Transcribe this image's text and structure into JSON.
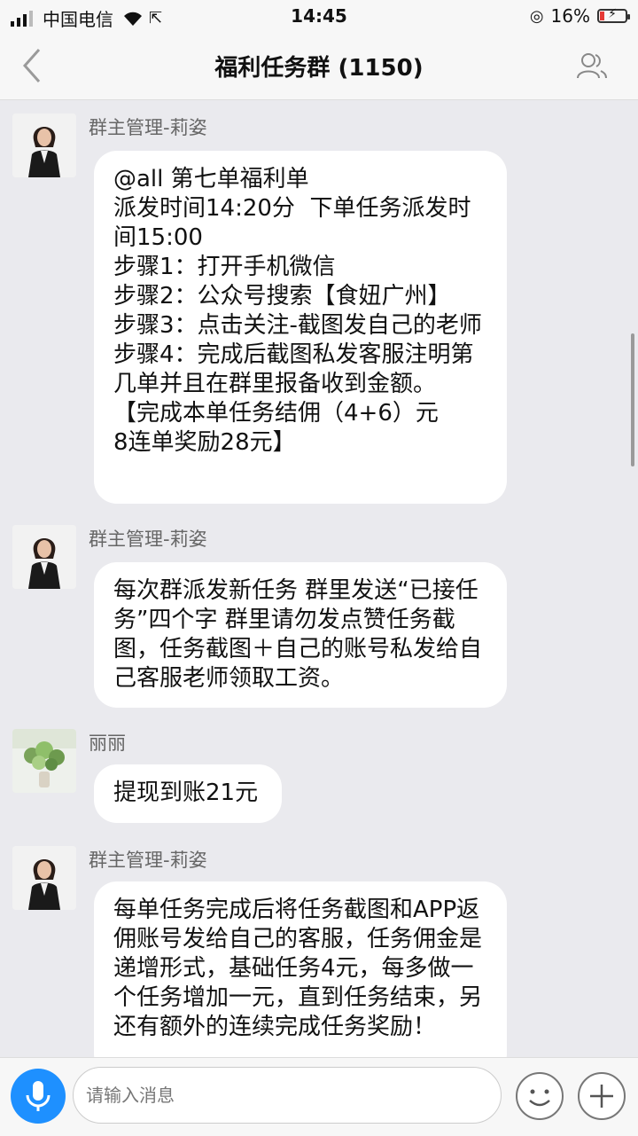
{
  "status_bar": {
    "carrier": "中国电信",
    "time": "14:45",
    "battery_text": "16%",
    "battery_level": 0.16,
    "battery_color": "#e53935"
  },
  "header": {
    "back_icon": "chevron-left-icon",
    "title": "福利任务群 (1150)",
    "members_icon": "group-members-icon"
  },
  "messages": [
    {
      "sender": "群主管理-莉姿",
      "avatar": "woman-in-black-suit-avatar",
      "text": "@all 第七单福利单\n派发时间14:20分  下单任务派发时间15:00\n步骤1：打开手机微信\n步骤2：公众号搜索【食妞广州】\n步骤3：点击关注-截图发自己的老师\n步骤4：完成后截图私发客服注明第几单并且在群里报备收到金额。\n【完成本单任务结佣（4+6）元\n8连单奖励28元】"
    },
    {
      "sender": "群主管理-莉姿",
      "avatar": "woman-in-black-suit-avatar",
      "text": "每次群派发新任务 群里发送“已接任务”四个字 群里请勿发点赞任务截图，任务截图＋自己的账号私发给自己客服老师领取工资。"
    },
    {
      "sender": "丽丽",
      "avatar": "flower-vase-avatar",
      "text": "提现到账21元"
    },
    {
      "sender": "群主管理-莉姿",
      "avatar": "woman-in-black-suit-avatar",
      "text": "每单任务完成后将任务截图和APP返佣账号发给自己的客服，任务佣金是递增形式，基础任务4元，每多做一个任务增加一元，直到任务结束，另还有额外的连续完成任务奖励！"
    }
  ],
  "input_bar": {
    "placeholder": "请输入消息",
    "voice_icon": "microphone-icon",
    "emoji_icon": "smiley-icon",
    "plus_icon": "plus-icon",
    "accent_color": "#1e90ff"
  }
}
